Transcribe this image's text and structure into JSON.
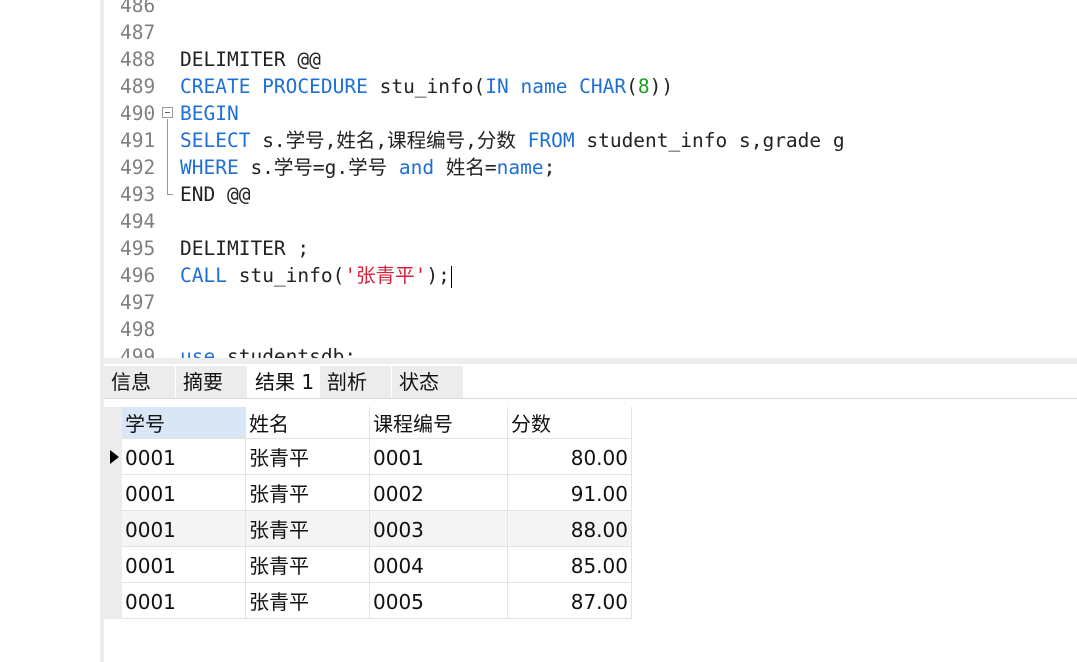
{
  "editor": {
    "lines": [
      {
        "num": "486",
        "segments": []
      },
      {
        "num": "487",
        "segments": []
      },
      {
        "num": "488",
        "segments": [
          {
            "t": "DELIMITER @@",
            "c": "plain"
          }
        ]
      },
      {
        "num": "489",
        "segments": [
          {
            "t": "CREATE PROCEDURE",
            "c": "kw"
          },
          {
            "t": " stu_info(",
            "c": "plain"
          },
          {
            "t": "IN name CHAR",
            "c": "kw"
          },
          {
            "t": "(",
            "c": "plain"
          },
          {
            "t": "8",
            "c": "num"
          },
          {
            "t": "))",
            "c": "plain"
          }
        ]
      },
      {
        "num": "490",
        "segments": [
          {
            "t": "BEGIN",
            "c": "kw"
          }
        ]
      },
      {
        "num": "491",
        "segments": [
          {
            "t": "SELECT",
            "c": "kw"
          },
          {
            "t": " s.学号,姓名,课程编号,分数 ",
            "c": "plain"
          },
          {
            "t": "FROM",
            "c": "kw"
          },
          {
            "t": " student_info s,grade g",
            "c": "plain"
          }
        ]
      },
      {
        "num": "492",
        "segments": [
          {
            "t": "WHERE",
            "c": "kw"
          },
          {
            "t": " s.学号=g.学号 ",
            "c": "plain"
          },
          {
            "t": "and",
            "c": "kw"
          },
          {
            "t": " 姓名=",
            "c": "plain"
          },
          {
            "t": "name",
            "c": "kw"
          },
          {
            "t": ";",
            "c": "plain"
          }
        ]
      },
      {
        "num": "493",
        "segments": [
          {
            "t": "END",
            "c": "plain"
          },
          {
            "t": " @@",
            "c": "plain"
          }
        ]
      },
      {
        "num": "494",
        "segments": []
      },
      {
        "num": "495",
        "segments": [
          {
            "t": "DELIMITER ;",
            "c": "plain"
          }
        ]
      },
      {
        "num": "496",
        "segments": [
          {
            "t": "CALL",
            "c": "kw"
          },
          {
            "t": " stu_info(",
            "c": "plain"
          },
          {
            "t": "'张青平'",
            "c": "str"
          },
          {
            "t": ");",
            "c": "plain"
          }
        ]
      },
      {
        "num": "497",
        "segments": []
      },
      {
        "num": "498",
        "segments": []
      },
      {
        "num": "499",
        "segments": [
          {
            "t": "use",
            "c": "kw"
          },
          {
            "t": " studentsdb;",
            "c": "plain"
          }
        ]
      }
    ]
  },
  "result_tabs": [
    {
      "label": "信息",
      "active": false
    },
    {
      "label": "摘要",
      "active": false
    },
    {
      "label": "结果 1",
      "active": true
    },
    {
      "label": "剖析",
      "active": false
    },
    {
      "label": "状态",
      "active": false
    }
  ],
  "grid": {
    "columns": [
      "学号",
      "姓名",
      "课程编号",
      "分数"
    ],
    "rows": [
      [
        "0001",
        "张青平",
        "0001",
        "80.00"
      ],
      [
        "0001",
        "张青平",
        "0002",
        "91.00"
      ],
      [
        "0001",
        "张青平",
        "0003",
        "88.00"
      ],
      [
        "0001",
        "张青平",
        "0004",
        "85.00"
      ],
      [
        "0001",
        "张青平",
        "0005",
        "87.00"
      ]
    ]
  },
  "colors": {
    "keyword": "#1e6fd6",
    "number": "#1aa01a",
    "string": "#d92039"
  }
}
